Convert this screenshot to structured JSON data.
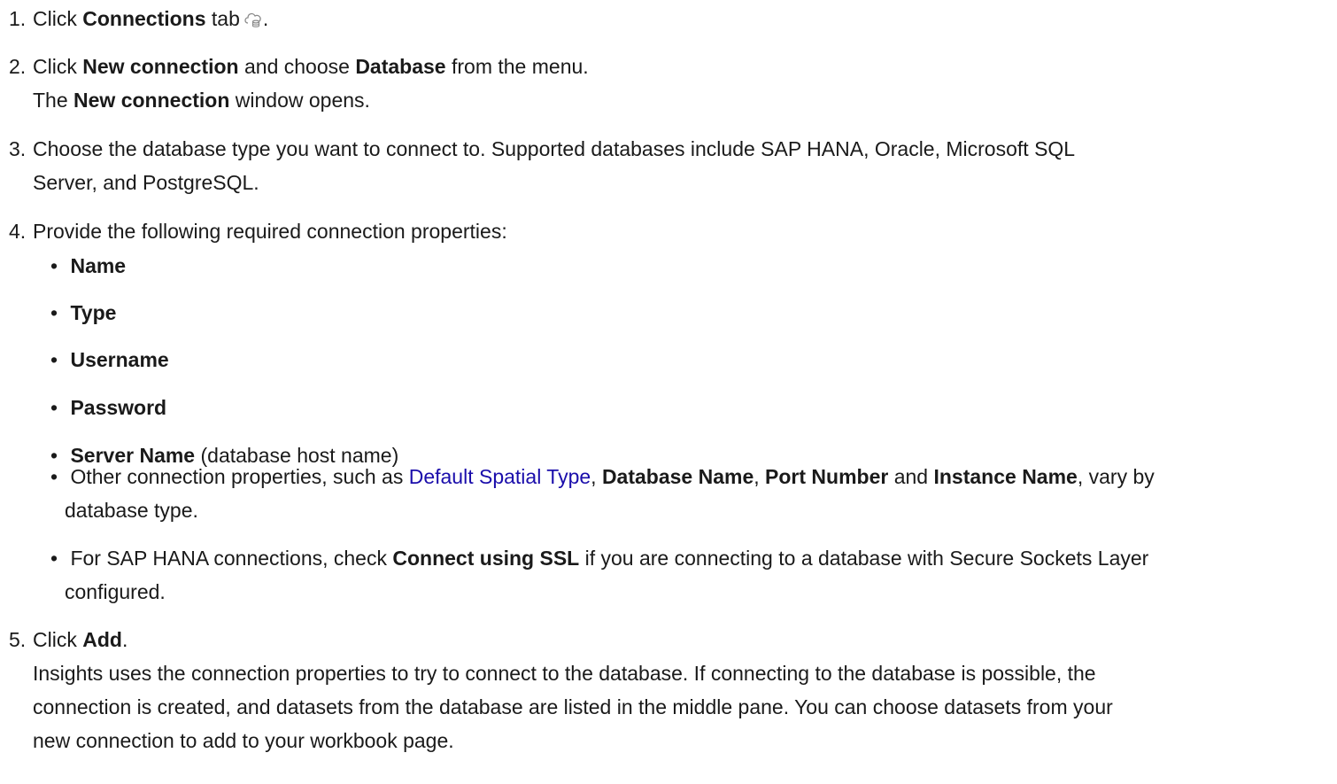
{
  "steps": [
    {
      "num": "1.",
      "pre": "Click ",
      "bold": "Connections",
      "post": " tab",
      "icon": "connections-cloud-icon",
      "end": "."
    },
    {
      "num": "2.",
      "l1_pre": "Click ",
      "l1_b1": "New connection",
      "l1_mid": " and choose ",
      "l1_b2": "Database",
      "l1_post": " from the menu.",
      "l2_pre": "The ",
      "l2_b": "New connection",
      "l2_post": " window opens."
    },
    {
      "num": "3.",
      "l1": "Choose the database type you want to connect to. Supported databases include SAP HANA, Oracle, Microsoft SQL",
      "l2": "Server, and PostgreSQL."
    },
    {
      "num": "4.",
      "l1": "Provide the following required connection properties:",
      "bullets": {
        "name": "Name",
        "type": "Type",
        "username": "Username",
        "password": "Password",
        "server_b": "Server Name",
        "server_rest": " (database host name)",
        "other_pre": "Other connection properties, such as ",
        "other_link": "Default Spatial Type",
        "other_comma": ", ",
        "other_b1": "Database Name",
        "other_comma2": ", ",
        "other_b2": "Port Number",
        "other_and": " and ",
        "other_b3": "Instance Name",
        "other_post": ", vary by",
        "other_l2": "database type.",
        "ssl_pre": "For SAP HANA connections, check ",
        "ssl_b": "Connect using SSL",
        "ssl_post": " if you are connecting to a database with Secure Sockets Layer",
        "ssl_l2": "configured."
      }
    },
    {
      "num": "5.",
      "pre": "Click ",
      "bold": "Add",
      "post": ".",
      "p1": "Insights uses the connection properties to try to connect to the database. If connecting to the database is possible, the",
      "p2": "connection is created, and datasets from the database are listed in the middle pane. You can choose datasets from your",
      "p3": "new connection to add to your workbook page."
    }
  ],
  "bullet_char": "•",
  "link_color": "#1a0dab"
}
